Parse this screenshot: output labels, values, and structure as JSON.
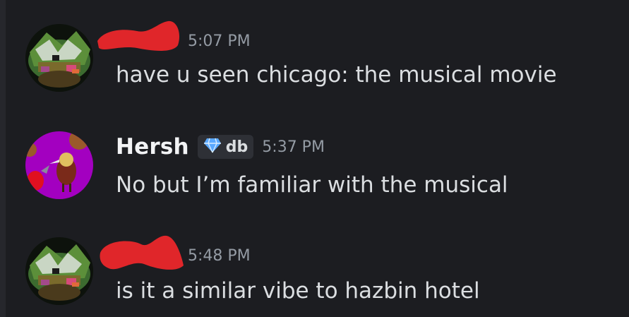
{
  "messages": [
    {
      "author": "",
      "avatar_icon": "turtle-pixel-avatar",
      "timestamp": "5:07 PM",
      "text": "have u seen chicago: the musical movie"
    },
    {
      "author": "Hersh",
      "avatar_icon": "bird-balloon-avatar",
      "tag_icon": "diamond-icon",
      "tag_label": "db",
      "timestamp": "5:37 PM",
      "text": "No but I’m familiar with the musical"
    },
    {
      "author": "",
      "avatar_icon": "turtle-pixel-avatar",
      "timestamp": "5:48 PM",
      "text": "is it a similar vibe to hazbin hotel"
    }
  ],
  "colors": {
    "background": "#1c1d21",
    "username": "#f2f3f5",
    "message_text": "#dbdee1",
    "timestamp": "#949ba4",
    "redaction": "#e0262a",
    "tag_background": "#2e3036",
    "gem": "#5aa8ff"
  }
}
